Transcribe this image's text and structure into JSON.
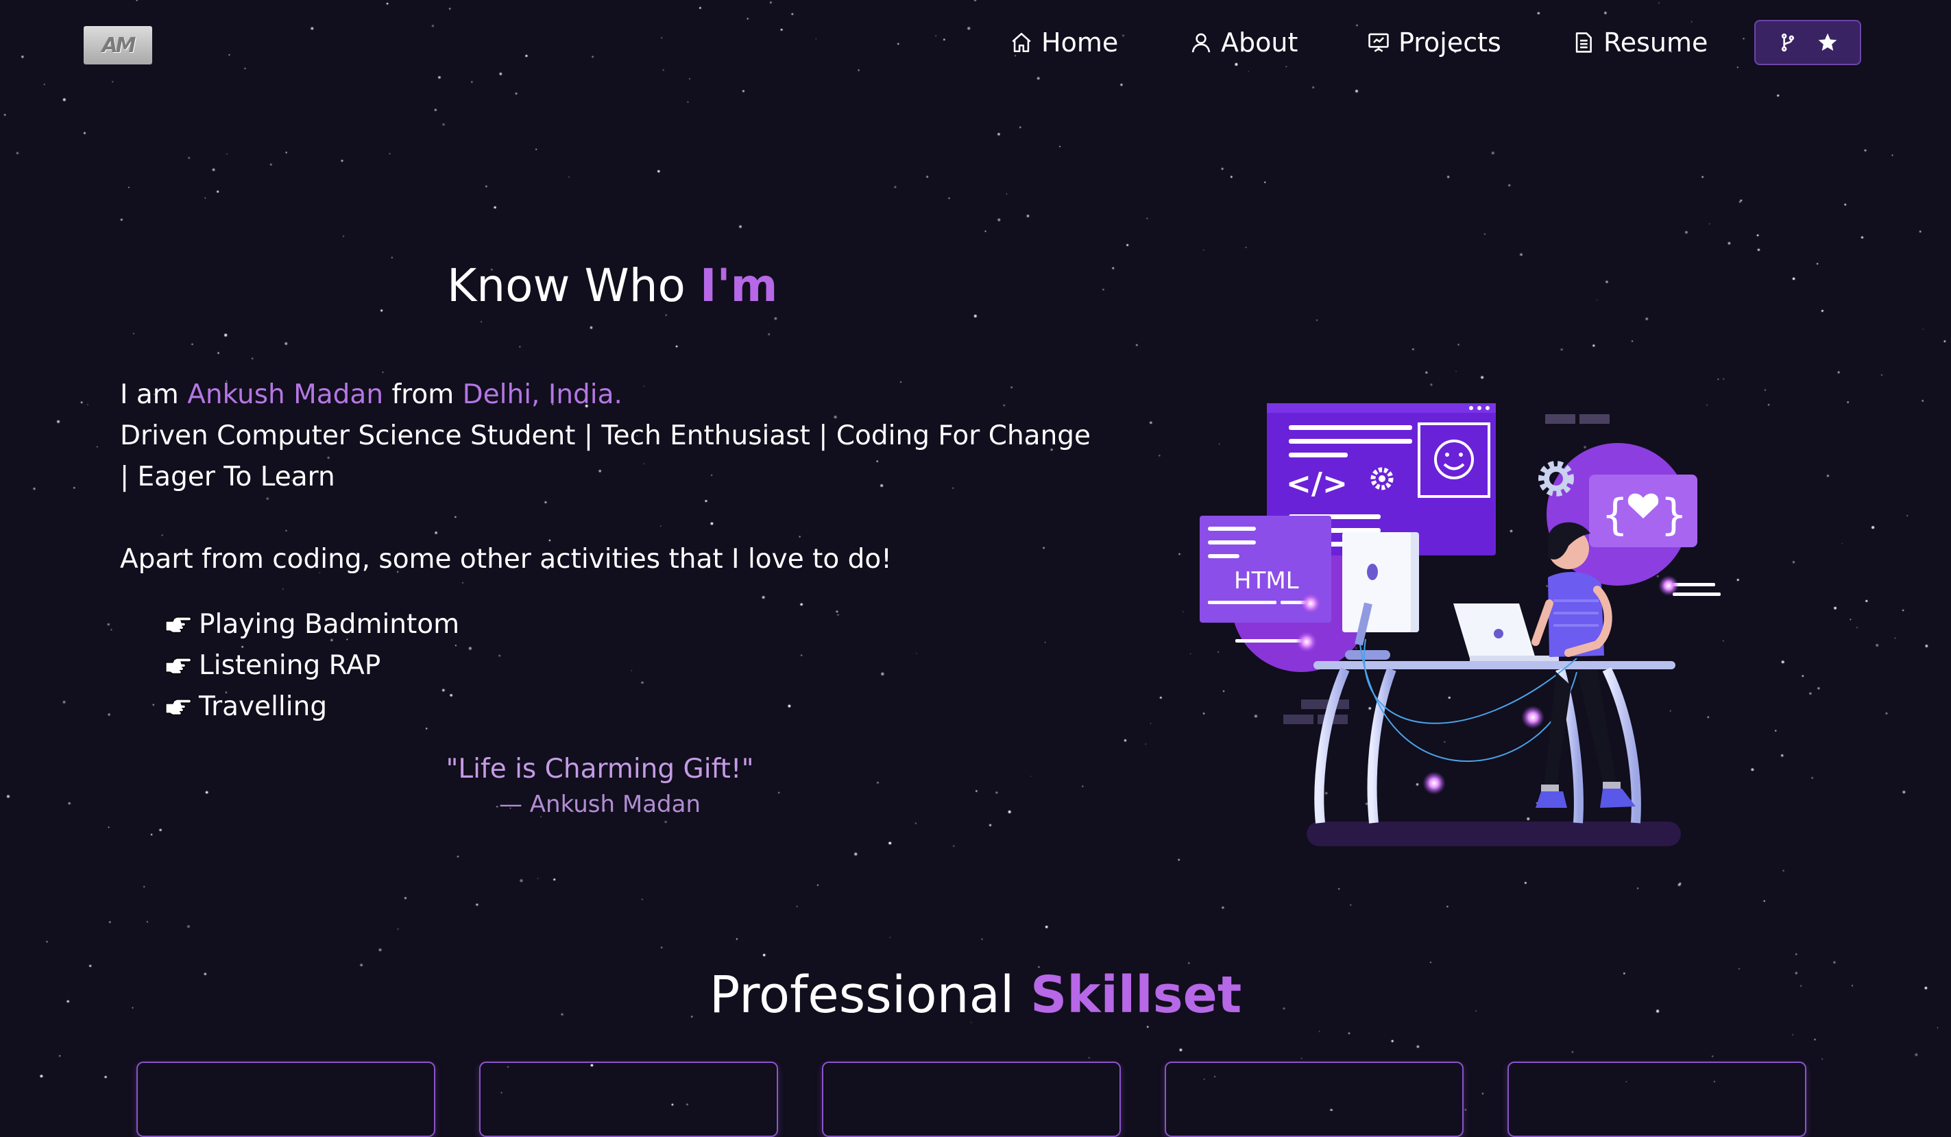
{
  "logo": {
    "text": "AM"
  },
  "nav": {
    "items": [
      {
        "label": "Home",
        "icon": "home-icon"
      },
      {
        "label": "About",
        "icon": "user-icon"
      },
      {
        "label": "Projects",
        "icon": "presentation-icon"
      },
      {
        "label": "Resume",
        "icon": "document-icon"
      }
    ],
    "github_button": {
      "icons": [
        "git-fork-icon",
        "star-icon"
      ]
    }
  },
  "about": {
    "heading_prefix": "Know Who ",
    "heading_accent": "I'm",
    "intro_1": "I am ",
    "name": "Ankush Madan",
    "intro_2": " from ",
    "location": "Delhi, India.",
    "tagline": "Driven Computer Science Student | Tech Enthusiast | Coding For Change | Eager To Learn",
    "activities_intro": "Apart from coding, some other activities that I love to do!",
    "activities": [
      "Playing Badmintom",
      "Listening RAP",
      "Travelling"
    ],
    "quote": "\"Life is Charming Gift!\"",
    "quote_author": "— Ankush Madan"
  },
  "illustration": {
    "label": "HTML"
  },
  "skillset": {
    "heading_prefix": "Professional ",
    "heading_accent": "Skillset",
    "card_count": 5
  },
  "colors": {
    "background": "#110e1d",
    "accent": "#b668e6",
    "card_border": "#8a54c9",
    "button_bg": "#3a2363"
  }
}
